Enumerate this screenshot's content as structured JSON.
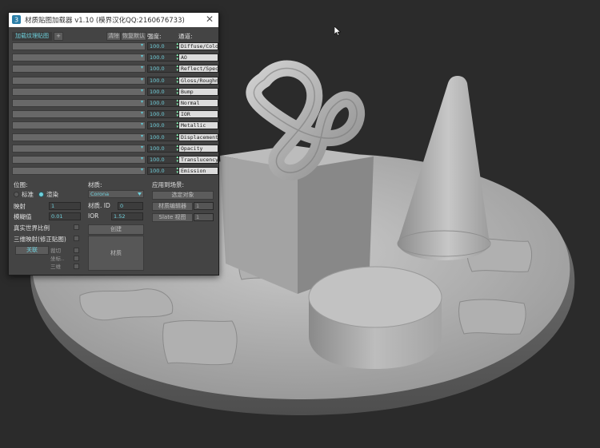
{
  "window": {
    "title": "材质贴图加载器 v1.10 (模界汉化QQ:2160676733)",
    "close": "✕"
  },
  "toolbar": {
    "load_texture_label": "加载纹理贴图",
    "add_label": "+",
    "clear_label": "清除",
    "reset_label": "恢复默认",
    "strength_header": "强度:",
    "channel_header": "通道:"
  },
  "rows": [
    {
      "strength": "100.0",
      "channel": "Diffuse/Color"
    },
    {
      "strength": "100.0",
      "channel": "AO"
    },
    {
      "strength": "100.0",
      "channel": "Reflect/Specular"
    },
    {
      "strength": "100.0",
      "channel": "Gloss/Roughness"
    },
    {
      "strength": "100.0",
      "channel": "Bump"
    },
    {
      "strength": "100.0",
      "channel": "Normal"
    },
    {
      "strength": "100.0",
      "channel": "IOR"
    },
    {
      "strength": "100.0",
      "channel": "Metallic"
    },
    {
      "strength": "100.0",
      "channel": "Displacement"
    },
    {
      "strength": "100.0",
      "channel": "Opacity"
    },
    {
      "strength": "100.0",
      "channel": "Translucency"
    },
    {
      "strength": "100.0",
      "channel": "Emission"
    }
  ],
  "bitmap": {
    "header": "位图:",
    "radio_standard": "标准",
    "radio_render": "渲染",
    "mapping_label": "映射",
    "mapping_value": "1",
    "blur_label": "模糊值",
    "blur_value": "0.01",
    "real_world_label": "真实世界比例",
    "triplanar_label": "三维映射(修正贴图)",
    "close_label": "关联",
    "crop_label": "裁切",
    "coord_label": "坐标..",
    "three_label": "三维"
  },
  "material": {
    "header": "材质:",
    "renderer": "Corona",
    "id_label": "材质. ID",
    "id_value": "0",
    "ior_label": "IOR",
    "ior_value": "1.52",
    "create_label": "创建",
    "material_label": "材质"
  },
  "apply": {
    "header": "应用到场景:",
    "selected_label": "选定对象",
    "editor_label": "材质编辑器",
    "editor_value": "1",
    "slate_label": "Slate 视图",
    "slate_value": "1"
  },
  "colors": {
    "accent": "#6fd0dc",
    "panel": "#444444",
    "viewport": "#2b2b2b"
  }
}
